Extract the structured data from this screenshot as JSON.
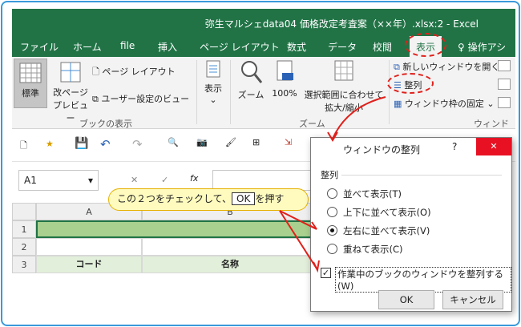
{
  "window": {
    "title": "弥生マルシェdata04 価格改定考査案（××年）.xlsx:2 - Excel"
  },
  "tabs": [
    "ファイル",
    "ホーム",
    "file",
    "挿入",
    "ページ レイアウト",
    "数式",
    "データ",
    "校閲",
    "表示",
    "操作アシス"
  ],
  "ribbon": {
    "normal": "標準",
    "page_break_1": "改ページ",
    "page_break_2": "プレビュー",
    "page_layout": "ページ レイアウト",
    "custom_view": "ユーザー設定のビュー",
    "group_book_view": "ブックの表示",
    "show": "表示",
    "zoom": "ズーム",
    "zoom100": "100%",
    "zoom_sel_1": "選択範囲に合わせて",
    "zoom_sel_2": "拡大/縮小",
    "group_zoom": "ズーム",
    "new_window": "新しいウィンドウを開く",
    "arrange": "整列",
    "freeze": "ウィンドウ枠の固定",
    "group_window": "ウィンドウ"
  },
  "formula_bar": {
    "name_box": "A1",
    "fx": "fx"
  },
  "grid": {
    "columns": [
      "A",
      "B"
    ],
    "rows": [
      "1",
      "2",
      "3"
    ],
    "row3": {
      "a": "コード",
      "b": "名称"
    }
  },
  "dialog": {
    "title": "ウィンドウの整列",
    "help": "?",
    "close": "✕",
    "section": "整列",
    "options": [
      "並べて表示(T)",
      "上下に並べて表示(O)",
      "左右に並べて表示(V)",
      "重ねて表示(C)"
    ],
    "checkbox": "作業中のブックのウィンドウを整列する(W)",
    "ok": "OK",
    "cancel": "キャンセル"
  },
  "callout": {
    "text_1": "この２つをチェックして、",
    "ok": "OK",
    "text_2": "を押す"
  }
}
